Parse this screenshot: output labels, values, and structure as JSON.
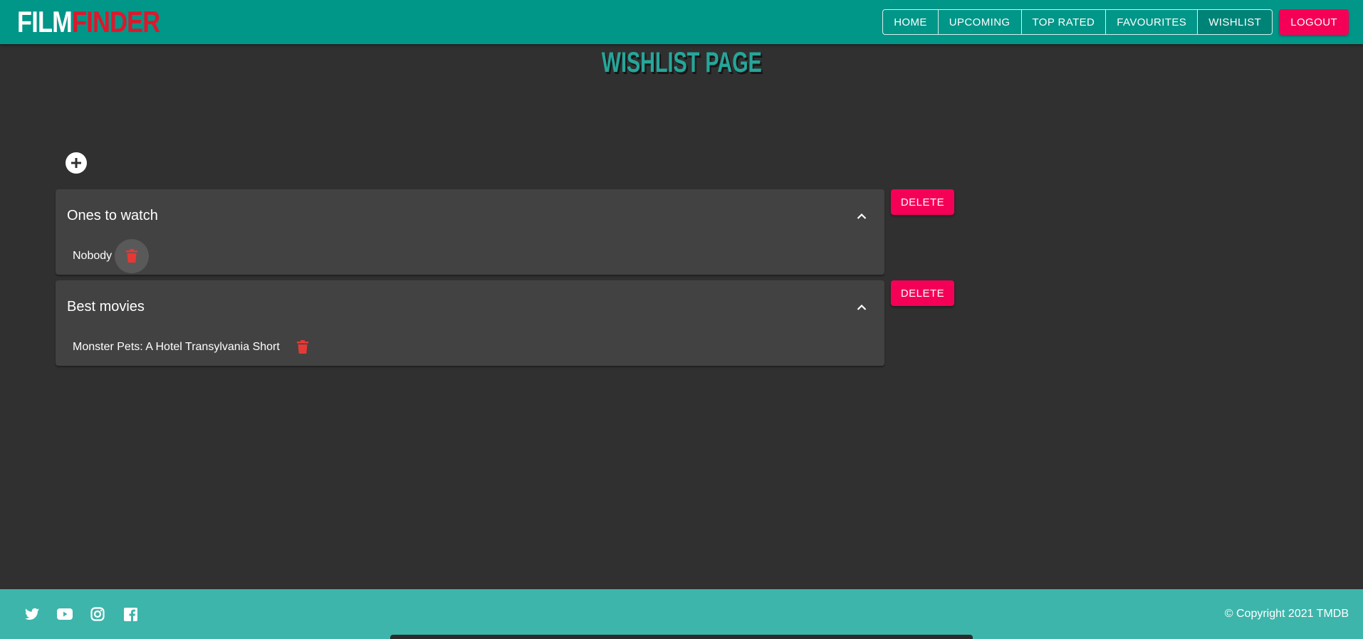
{
  "header": {
    "logo_part1": "FILM",
    "logo_part2": "FINDER",
    "nav": [
      {
        "label": "HOME"
      },
      {
        "label": "UPCOMING"
      },
      {
        "label": "TOP RATED"
      },
      {
        "label": "FAVOURITES"
      },
      {
        "label": "WISHLIST"
      }
    ],
    "logout_label": "LOGOUT"
  },
  "page": {
    "title": "WISHLIST PAGE",
    "add_icon": "plus-circle-icon"
  },
  "wishlists": [
    {
      "name": "Ones to watch",
      "delete_label": "DELETE",
      "items": [
        "Nobody"
      ]
    },
    {
      "name": "Best movies",
      "delete_label": "DELETE",
      "items": [
        "Monster Pets: A Hotel Transylvania Short"
      ]
    }
  ],
  "footer": {
    "social_icons": [
      "twitter-icon",
      "youtube-icon",
      "instagram-icon",
      "facebook-icon"
    ],
    "copyright": "© Copyright 2021 TMDB"
  },
  "colors": {
    "primary": "#009688",
    "accent": "#f50057",
    "background": "#303030",
    "panel": "#424242",
    "footer": "#3db5ab",
    "trash": "#e53935"
  }
}
